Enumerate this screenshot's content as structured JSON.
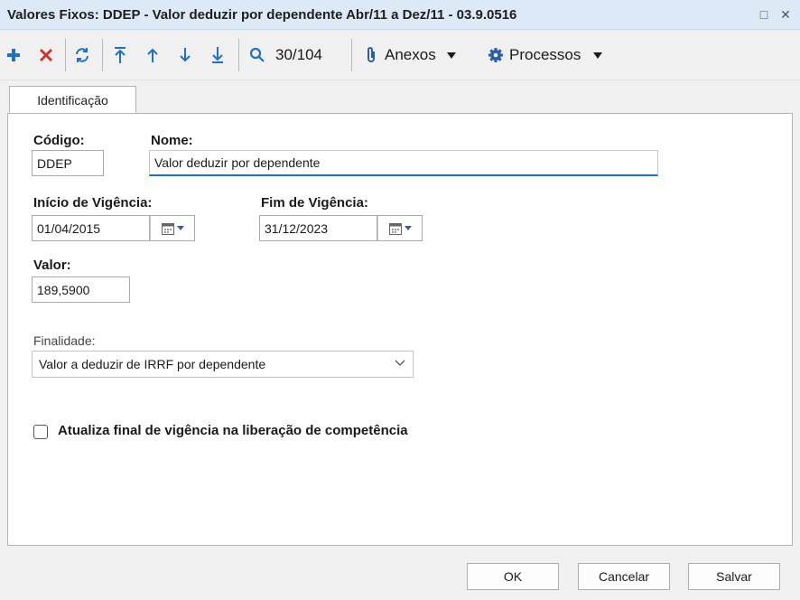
{
  "window": {
    "title": "Valores Fixos: DDEP - Valor deduzir por dependente  Abr/11 a Dez/11 - 03.9.0516",
    "maximize_glyph": "□",
    "close_glyph": "✕"
  },
  "toolbar": {
    "record_counter": "30/104",
    "anexos_label": "Anexos",
    "processos_label": "Processos",
    "icons": [
      "add-icon",
      "delete-icon",
      "refresh-icon",
      "first-record-icon",
      "previous-record-icon",
      "next-record-icon",
      "last-record-icon",
      "search-icon",
      "paperclip-icon",
      "gear-icon"
    ],
    "colors": {
      "add": "#1f6fc5",
      "delete": "#d32f2f",
      "nav": "#1f6fc5"
    }
  },
  "tabs": [
    {
      "label": "Identificação",
      "active": true
    }
  ],
  "form": {
    "codigo": {
      "label": "Código:",
      "value": "DDEP"
    },
    "nome": {
      "label": "Nome:",
      "value": "Valor deduzir por dependente"
    },
    "inicio_vigencia": {
      "label": "Início de Vigência:",
      "value": "01/04/2015"
    },
    "fim_vigencia": {
      "label": "Fim de Vigência:",
      "value": "31/12/2023"
    },
    "valor": {
      "label": "Valor:",
      "value": "189,5900"
    },
    "finalidade": {
      "label": "Finalidade:",
      "selected": "Valor a deduzir de IRRF por dependente"
    },
    "atualiza_checkbox": {
      "label": "Atualiza final de vigência na liberação de competência",
      "checked": false
    }
  },
  "footer": {
    "ok_label": "OK",
    "cancel_label": "Cancelar",
    "save_label": "Salvar"
  }
}
